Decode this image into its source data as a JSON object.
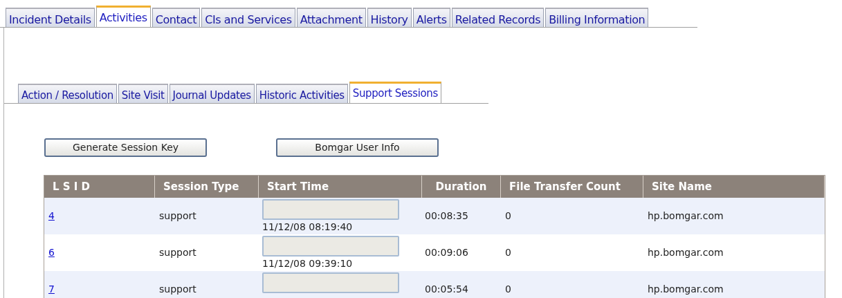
{
  "tabs": [
    {
      "label": "Incident Details",
      "selected": false
    },
    {
      "label": "Activities",
      "selected": true
    },
    {
      "label": "Contact",
      "selected": false
    },
    {
      "label": "CIs and Services",
      "selected": false
    },
    {
      "label": "Attachment",
      "selected": false
    },
    {
      "label": "History",
      "selected": false
    },
    {
      "label": "Alerts",
      "selected": false
    },
    {
      "label": "Related Records",
      "selected": false
    },
    {
      "label": "Billing Information",
      "selected": false
    }
  ],
  "subtabs": [
    {
      "label": "Action / Resolution",
      "selected": false
    },
    {
      "label": "Site Visit",
      "selected": false
    },
    {
      "label": "Journal Updates",
      "selected": false
    },
    {
      "label": "Historic Activities",
      "selected": false
    },
    {
      "label": "Support Sessions",
      "selected": true
    }
  ],
  "buttons": [
    "Generate Session Key",
    "Bomgar User Info"
  ],
  "table": {
    "columns": [
      "L S I D",
      "Session Type",
      "Start Time",
      "Duration",
      "File Transfer Count",
      "Site Name"
    ],
    "rows": [
      {
        "lsid": "4",
        "session_type": "support",
        "start_time": "11/12/08 08:19:40",
        "duration": "00:08:35",
        "file_transfer_count": "0",
        "site_name": "hp.bomgar.com"
      },
      {
        "lsid": "6",
        "session_type": "support",
        "start_time": "11/12/08 09:39:10",
        "duration": "00:09:06",
        "file_transfer_count": "0",
        "site_name": "hp.bomgar.com"
      },
      {
        "lsid": "7",
        "session_type": "support",
        "duration": "00:05:54",
        "file_transfer_count": "0",
        "site_name": "hp.bomgar.com"
      }
    ]
  }
}
